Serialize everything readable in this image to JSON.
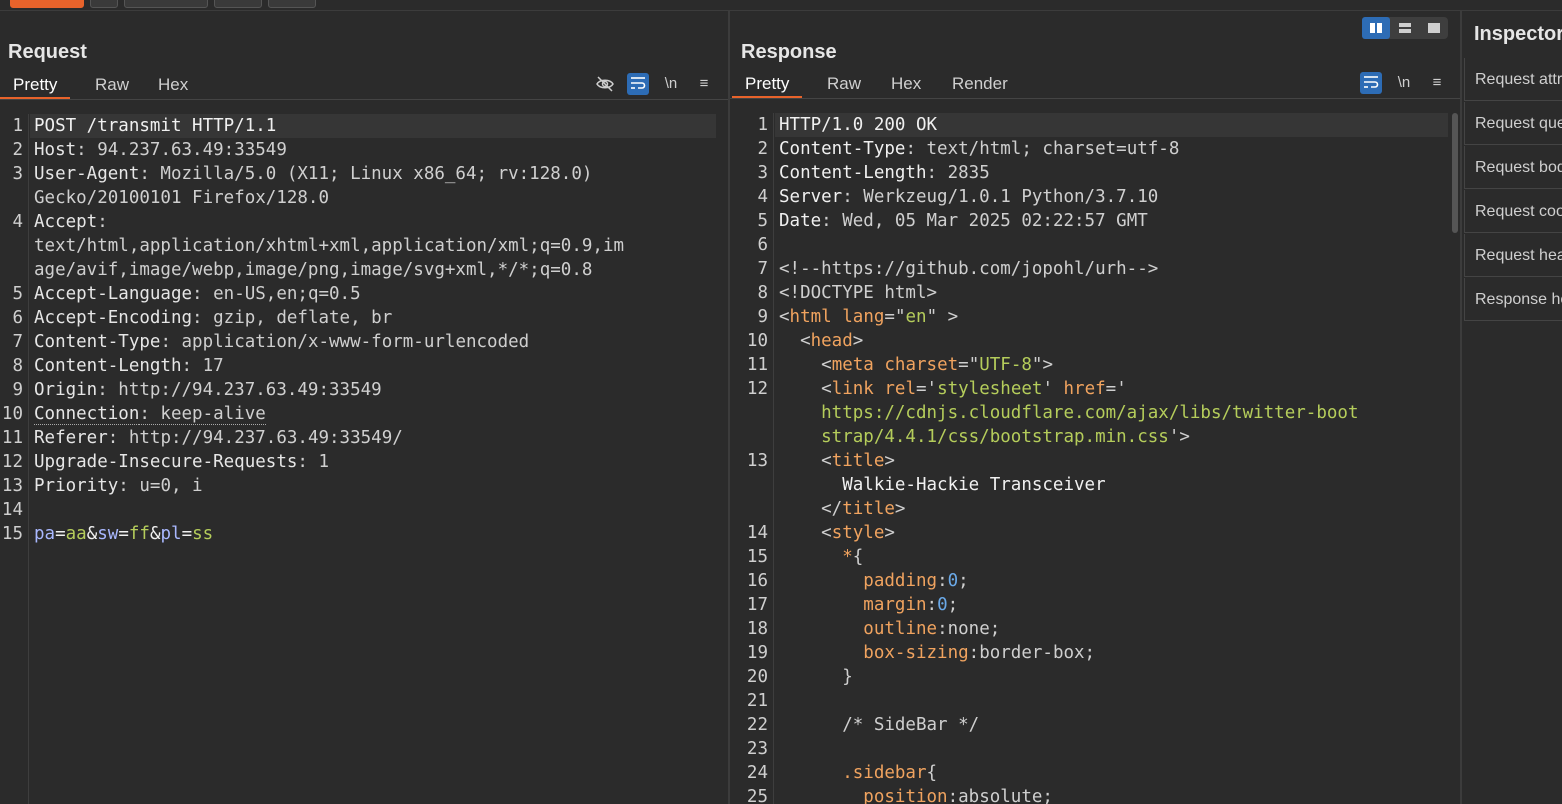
{
  "request": {
    "title": "Request",
    "tabs": [
      "Pretty",
      "Raw",
      "Hex"
    ],
    "active_tab": "Pretty",
    "tools": {
      "newline": "\\n"
    },
    "lines": [
      {
        "n": "1",
        "parts": [
          [
            "w",
            "POST /transmit HTTP/1.1"
          ]
        ]
      },
      {
        "n": "2",
        "parts": [
          [
            "k",
            "Host"
          ],
          [
            "reqval",
            ": 94.237.63.49:33549"
          ]
        ]
      },
      {
        "n": "3",
        "parts": [
          [
            "k",
            "User-Agent"
          ],
          [
            "reqval",
            ": Mozilla/5.0 (X11; Linux x86_64; rv:128.0)"
          ]
        ]
      },
      {
        "n": "",
        "parts": [
          [
            "reqval",
            "Gecko/20100101 Firefox/128.0"
          ]
        ]
      },
      {
        "n": "4",
        "parts": [
          [
            "k",
            "Accept"
          ],
          [
            "reqval",
            ":"
          ]
        ]
      },
      {
        "n": "",
        "parts": [
          [
            "reqval",
            "text/html,application/xhtml+xml,application/xml;q=0.9,im"
          ]
        ]
      },
      {
        "n": "",
        "parts": [
          [
            "reqval",
            "age/avif,image/webp,image/png,image/svg+xml,*/*;q=0.8"
          ]
        ]
      },
      {
        "n": "5",
        "parts": [
          [
            "k",
            "Accept-Language"
          ],
          [
            "reqval",
            ": en-US,en;q=0.5"
          ]
        ]
      },
      {
        "n": "6",
        "parts": [
          [
            "k",
            "Accept-Encoding"
          ],
          [
            "reqval",
            ": gzip, deflate, br"
          ]
        ]
      },
      {
        "n": "7",
        "parts": [
          [
            "k",
            "Content-Type"
          ],
          [
            "reqval",
            ": application/x-www-form-urlencoded"
          ]
        ]
      },
      {
        "n": "8",
        "parts": [
          [
            "k",
            "Content-Length"
          ],
          [
            "reqval",
            ": 17"
          ]
        ]
      },
      {
        "n": "9",
        "parts": [
          [
            "k",
            "Origin"
          ],
          [
            "reqval",
            ": http://94.237.63.49:33549"
          ]
        ]
      },
      {
        "n": "10",
        "parts": [
          [
            "k dotted",
            "Connection"
          ],
          [
            "reqval dotted",
            ": keep-alive"
          ]
        ]
      },
      {
        "n": "11",
        "parts": [
          [
            "k",
            "Referer"
          ],
          [
            "reqval",
            ": http://94.237.63.49:33549/"
          ]
        ]
      },
      {
        "n": "12",
        "parts": [
          [
            "k",
            "Upgrade-Insecure-Requests"
          ],
          [
            "reqval",
            ": 1"
          ]
        ]
      },
      {
        "n": "13",
        "parts": [
          [
            "k",
            "Priority"
          ],
          [
            "reqval",
            ": u=0, i"
          ]
        ]
      },
      {
        "n": "14",
        "parts": []
      },
      {
        "n": "15",
        "parts": [
          [
            "pn",
            "pa"
          ],
          [
            "w",
            "="
          ],
          [
            "pv",
            "aa"
          ],
          [
            "w",
            "&"
          ],
          [
            "pn",
            "sw"
          ],
          [
            "w",
            "="
          ],
          [
            "pv",
            "ff"
          ],
          [
            "w",
            "&"
          ],
          [
            "pn",
            "pl"
          ],
          [
            "w",
            "="
          ],
          [
            "pv",
            "ss"
          ]
        ]
      }
    ]
  },
  "response": {
    "title": "Response",
    "tabs": [
      "Pretty",
      "Raw",
      "Hex",
      "Render"
    ],
    "active_tab": "Pretty",
    "tools": {
      "newline": "\\n"
    },
    "lines": [
      {
        "n": "1",
        "parts": [
          [
            "w",
            "HTTP/1.0 200 OK"
          ]
        ]
      },
      {
        "n": "2",
        "parts": [
          [
            "w",
            "Content-Type"
          ],
          [
            "v",
            ": text/html; charset=utf-8"
          ]
        ]
      },
      {
        "n": "3",
        "parts": [
          [
            "w",
            "Content-Length"
          ],
          [
            "v",
            ": 2835"
          ]
        ]
      },
      {
        "n": "4",
        "parts": [
          [
            "w",
            "Server"
          ],
          [
            "v",
            ": Werkzeug/1.0.1 Python/3.7.10"
          ]
        ]
      },
      {
        "n": "5",
        "parts": [
          [
            "w",
            "Date"
          ],
          [
            "v",
            ": Wed, 05 Mar 2025 02:22:57 GMT"
          ]
        ]
      },
      {
        "n": "6",
        "parts": []
      },
      {
        "n": "7",
        "parts": [
          [
            "cm",
            "<!--https://github.com/jopohl/urh-->"
          ]
        ]
      },
      {
        "n": "8",
        "parts": [
          [
            "cm",
            "<!DOCTYPE html>"
          ]
        ]
      },
      {
        "n": "9",
        "parts": [
          [
            "v",
            "<"
          ],
          [
            "tag",
            "html"
          ],
          [
            "v",
            " "
          ],
          [
            "attr",
            "lang"
          ],
          [
            "v",
            "=\""
          ],
          [
            "str",
            "en"
          ],
          [
            "v",
            "\" >"
          ]
        ]
      },
      {
        "n": "10",
        "parts": [
          [
            "v",
            "  <"
          ],
          [
            "tag",
            "head"
          ],
          [
            "v",
            ">"
          ]
        ]
      },
      {
        "n": "11",
        "parts": [
          [
            "v",
            "    <"
          ],
          [
            "tag",
            "meta"
          ],
          [
            "v",
            " "
          ],
          [
            "attr",
            "charset"
          ],
          [
            "v",
            "=\""
          ],
          [
            "str",
            "UTF-8"
          ],
          [
            "v",
            "\">"
          ]
        ]
      },
      {
        "n": "12",
        "parts": [
          [
            "v",
            "    <"
          ],
          [
            "tag",
            "link"
          ],
          [
            "v",
            " "
          ],
          [
            "attr",
            "rel"
          ],
          [
            "v",
            "='"
          ],
          [
            "str",
            "stylesheet"
          ],
          [
            "v",
            "' "
          ],
          [
            "attr",
            "href"
          ],
          [
            "v",
            "='"
          ]
        ]
      },
      {
        "n": "",
        "parts": [
          [
            "str",
            "    https://cdnjs.cloudflare.com/ajax/libs/twitter-boot"
          ]
        ]
      },
      {
        "n": "",
        "parts": [
          [
            "str",
            "    strap/4.4.1/css/bootstrap.min.css"
          ],
          [
            "v",
            "'>"
          ]
        ]
      },
      {
        "n": "13",
        "parts": [
          [
            "v",
            "    <"
          ],
          [
            "tag",
            "title"
          ],
          [
            "v",
            ">"
          ]
        ]
      },
      {
        "n": "",
        "parts": [
          [
            "w",
            "      Walkie-Hackie Transceiver"
          ]
        ]
      },
      {
        "n": "",
        "parts": [
          [
            "v",
            "    </"
          ],
          [
            "tag",
            "title"
          ],
          [
            "v",
            ">"
          ]
        ]
      },
      {
        "n": "14",
        "parts": [
          [
            "v",
            "    <"
          ],
          [
            "tag",
            "style"
          ],
          [
            "v",
            ">"
          ]
        ]
      },
      {
        "n": "15",
        "parts": [
          [
            "v",
            "      "
          ],
          [
            "tag",
            "*"
          ],
          [
            "v",
            "{"
          ]
        ]
      },
      {
        "n": "16",
        "parts": [
          [
            "v",
            "        "
          ],
          [
            "attr",
            "padding"
          ],
          [
            "v",
            ":"
          ],
          [
            "num",
            "0"
          ],
          [
            "v",
            ";"
          ]
        ]
      },
      {
        "n": "17",
        "parts": [
          [
            "v",
            "        "
          ],
          [
            "attr",
            "margin"
          ],
          [
            "v",
            ":"
          ],
          [
            "num",
            "0"
          ],
          [
            "v",
            ";"
          ]
        ]
      },
      {
        "n": "18",
        "parts": [
          [
            "v",
            "        "
          ],
          [
            "attr",
            "outline"
          ],
          [
            "v",
            ":none;"
          ]
        ]
      },
      {
        "n": "19",
        "parts": [
          [
            "v",
            "        "
          ],
          [
            "attr",
            "box-sizing"
          ],
          [
            "v",
            ":border-box;"
          ]
        ]
      },
      {
        "n": "20",
        "parts": [
          [
            "v",
            "      }"
          ]
        ]
      },
      {
        "n": "21",
        "parts": []
      },
      {
        "n": "22",
        "parts": [
          [
            "cm",
            "      /* SideBar */"
          ]
        ]
      },
      {
        "n": "23",
        "parts": []
      },
      {
        "n": "24",
        "parts": [
          [
            "v",
            "      "
          ],
          [
            "tag",
            ".sidebar"
          ],
          [
            "v",
            "{"
          ]
        ]
      },
      {
        "n": "25",
        "parts": [
          [
            "v",
            "        "
          ],
          [
            "attr",
            "position"
          ],
          [
            "v",
            ":absolute;"
          ]
        ]
      }
    ]
  },
  "inspector": {
    "title": "Inspector",
    "rows": [
      "Request attributes",
      "Request query parameters",
      "Request body parameters",
      "Request cookies",
      "Request headers",
      "Response headers"
    ]
  },
  "colors": {
    "accent": "#e8632b",
    "toggle_on": "#2d6cb5",
    "background": "#2b2b2b"
  }
}
